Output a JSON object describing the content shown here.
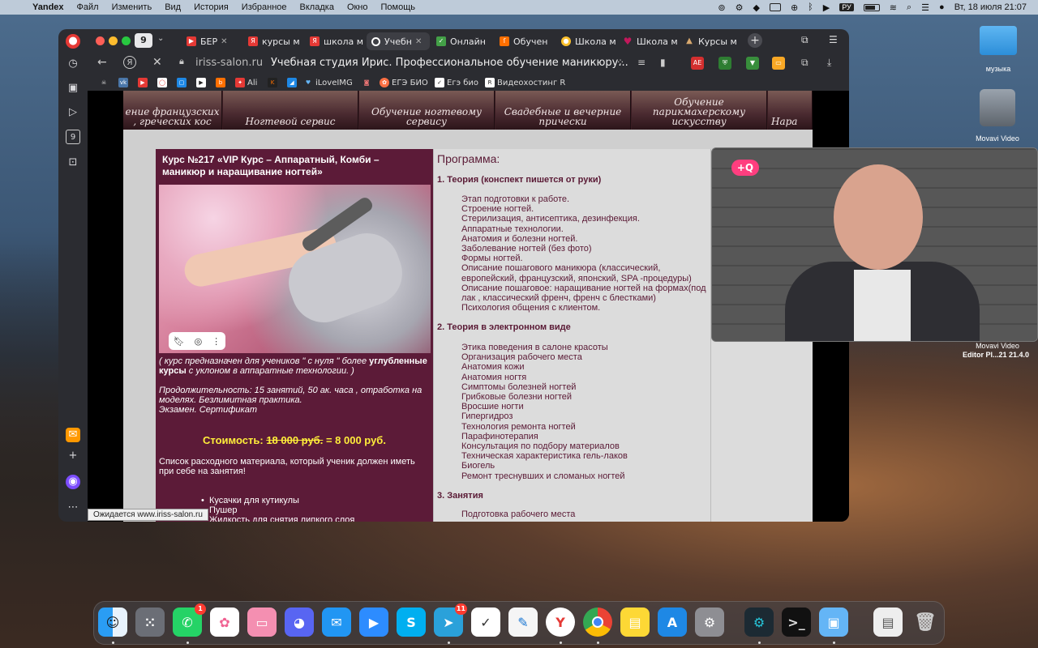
{
  "menubar": {
    "app": "Yandex",
    "items": [
      "Файл",
      "Изменить",
      "Вид",
      "История",
      "Избранное",
      "Вкладка",
      "Окно",
      "Помощь"
    ],
    "lang": "РУ",
    "datetime": "Вт, 18 июля  21:07"
  },
  "browser": {
    "tab_count": "9",
    "tabs": [
      {
        "label": "БЕР",
        "color": "#e53935"
      },
      {
        "label": "курсы м",
        "color": "#e53935"
      },
      {
        "label": "школа м",
        "color": "#e53935"
      },
      {
        "label": "Учебн",
        "color": "#ffffff"
      },
      {
        "label": "Онлайн",
        "color": "#43a047"
      },
      {
        "label": "Обучен",
        "color": "#ff6f00"
      },
      {
        "label": "Школа м",
        "color": "#fbc02d"
      },
      {
        "label": "Школа м",
        "color": "#c2185b"
      },
      {
        "label": "Курсы м",
        "color": "#8d6e63"
      }
    ],
    "url": "iriss-salon.ru",
    "page_title": "Учебная студия Ирис. Профессиональное обучение маникюру...",
    "bookmarks": [
      "Ali",
      "iLoveIMG",
      "ЕГЭ БИО",
      "Егэ био",
      "Видеохостинг R"
    ],
    "status": "Ожидается www.iriss-salon.ru"
  },
  "banner": [
    "ение французских , греческих кос",
    "Ногтевой сервис",
    "Обучение ногтевому сервису",
    "Свадебные и вечерние прически",
    "Обучение парикмахерскому искусству",
    "Нара"
  ],
  "course": {
    "title": "Курс №217 «VIP Курс – Аппаратный, Комби – маникюр и наращивание ногтей»",
    "note_a": "( курс предназначен для учеников \" с нуля \" более",
    "note_b": "углубленные курсы",
    "note_c": "с уклоном в аппаратные технологии. )",
    "duration": "Продолжительность: 15 занятий, 50 ак. часа , отработка на моделях. Безлимитная практика.",
    "exam": "Экзамен. Сертификат",
    "price_label": "Стоимость:",
    "price_old": "18 000 руб.",
    "price_new": "= 8 000 руб.",
    "materials_intro": "Список расходного материала, который ученик должен иметь при себе на занятия!",
    "materials": [
      "Кусачки для кутикулы",
      "Пушер",
      "Жидкость для снятия липкого слоя"
    ]
  },
  "program": {
    "heading": "Программа:",
    "sections": [
      {
        "title": "1. Теория  (конспект пишется от руки)",
        "items": [
          "Этап подготовки к работе.",
          "Строение ногтей.",
          "Стерилизация, антисептика, дезинфекция.",
          "Аппаратные технологии.",
          "Анатомия и болезни ногтей.",
          "Заболевание ногтей (без фото)",
          "Формы ногтей.",
          "Описание пошагового маникюра (классический,",
          "европейский, французский, японский, SPA -процедуры)",
          "Описание пошаговое: наращивание ногтей на формах(под",
          "лак , классический френч, френч с  блестками)",
          "Психология общения с клиентом."
        ]
      },
      {
        "title": "2. Теория в электронном виде",
        "items": [
          "Этика поведения в салоне красоты",
          "Организация рабочего места",
          "Анатомия кожи",
          "Анатомия ногтя",
          "Симптомы болезней ногтей",
          "Грибковые болезни ногтей",
          "Вросшие ногти",
          "Гипергидроз",
          "Технология ремонта ногтей",
          "Парафинотерапия",
          "Консультация по подбору материалов",
          "Техническая характеристика гель-лаков",
          "Биогель",
          "Ремонт треснувших и сломаных ногтей"
        ]
      },
      {
        "title": "3. Занятия",
        "items": [
          "Подготовка рабочего места"
        ]
      }
    ]
  },
  "desktop": {
    "folder_label": "музыка",
    "app_label_1": "Movavi Video",
    "app_label_2": "Editor Pl...21 21.4.0"
  },
  "dock": {
    "whatsapp_badge": "1",
    "telegram_badge": "11"
  }
}
